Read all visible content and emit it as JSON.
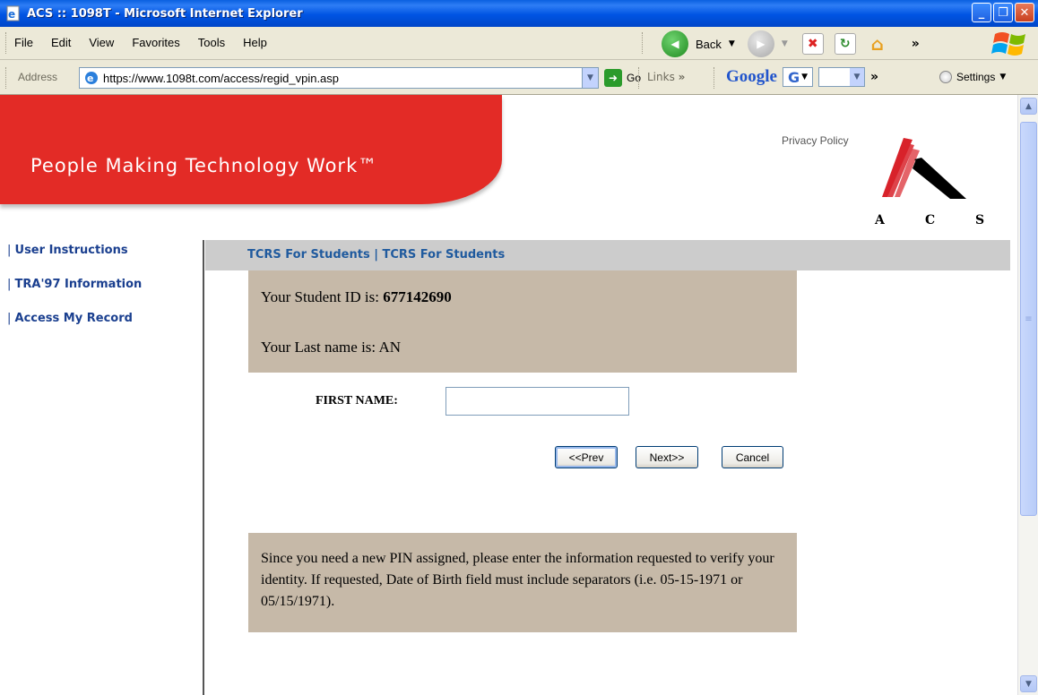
{
  "window": {
    "title": "ACS :: 1098T - Microsoft Internet Explorer",
    "controls": [
      "minimize",
      "maximize",
      "close"
    ]
  },
  "menu": {
    "items": [
      "File",
      "Edit",
      "View",
      "Favorites",
      "Tools",
      "Help"
    ],
    "back_label": "Back",
    "overflow": "»"
  },
  "address_bar": {
    "label": "Address",
    "url": "https://www.1098t.com/access/regid_vpin.asp",
    "go_label": "Go",
    "links_label": "Links",
    "overflow": "»",
    "google_label": "Google",
    "google_g": "G",
    "settings_label": "Settings"
  },
  "page": {
    "slogan": "People Making Technology Work™",
    "privacy_link": "Privacy Policy",
    "logo_text": [
      "A",
      "C",
      "S"
    ],
    "nav": [
      {
        "label": "User Instructions"
      },
      {
        "label": "TRA'97 Information"
      },
      {
        "label": "Access My Record"
      }
    ],
    "breadcrumb": "TCRS For Students | TCRS For Students",
    "student_id_prefix": "Your Student ID is:",
    "student_id": "677142690",
    "last_name_prefix": "Your Last name is:",
    "last_name": "AN",
    "first_name_label": "FIRST NAME:",
    "first_name_value": "",
    "buttons": {
      "prev": "<<Prev",
      "next": "Next>>",
      "cancel": "Cancel"
    },
    "help_text": "Since you need a new PIN assigned, please enter the information requested to verify your identity. If requested, Date of Birth field must include separators (i.e. 05-15-1971 or 05/15/1971)."
  },
  "colors": {
    "titlebar": "#0054e3",
    "banner_red": "#e32b26",
    "info_box": "#c6b9a8",
    "nav_link": "#1a3f8f",
    "breadcrumb_text": "#1f5a9e"
  }
}
